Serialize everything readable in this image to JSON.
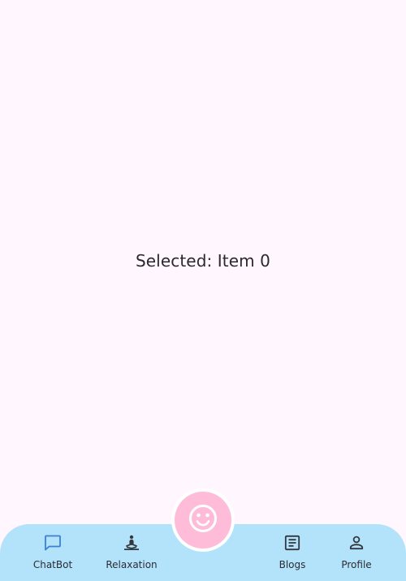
{
  "main": {
    "selected_text": "Selected: Item 0"
  },
  "nav": {
    "items": [
      {
        "label": "ChatBot",
        "icon": "chat-icon",
        "active": true
      },
      {
        "label": "Relaxation",
        "icon": "meditation-icon",
        "active": false
      },
      {
        "label": "Blogs",
        "icon": "article-icon",
        "active": false
      },
      {
        "label": "Profile",
        "icon": "person-icon",
        "active": false
      }
    ],
    "fab_icon": "smiley-face-icon"
  },
  "colors": {
    "background": "#fff7fd",
    "navbar": "#b3e3fa",
    "fab": "#ffbcd9",
    "active_icon": "#3b7fd6",
    "inactive_icon": "#333840"
  }
}
